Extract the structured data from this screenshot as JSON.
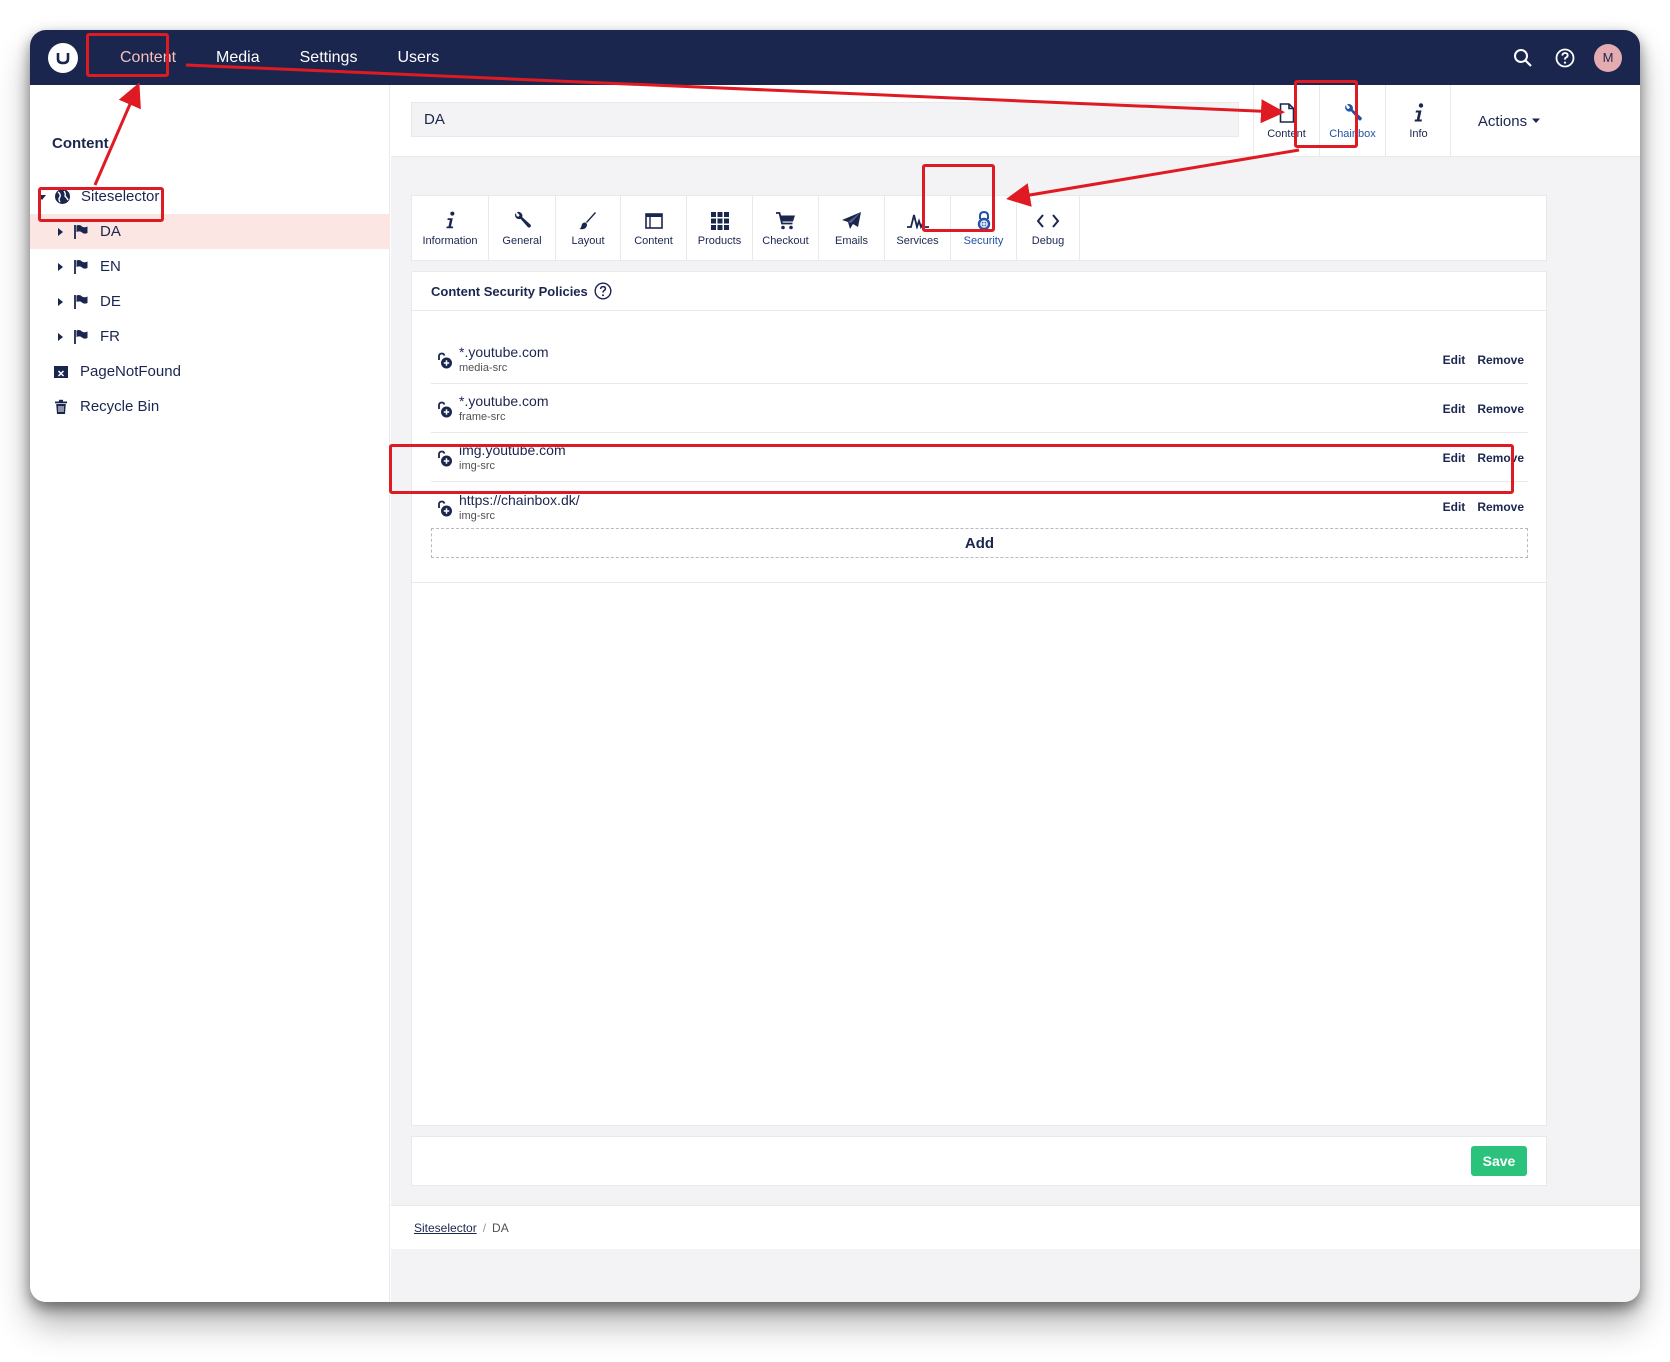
{
  "topnav": {
    "items": [
      {
        "label": "Content"
      },
      {
        "label": "Media"
      },
      {
        "label": "Settings"
      },
      {
        "label": "Users"
      }
    ],
    "avatar_initial": "M"
  },
  "sidebar": {
    "title": "Content",
    "root": {
      "label": "Siteselector"
    },
    "items": [
      {
        "label": "DA"
      },
      {
        "label": "EN"
      },
      {
        "label": "DE"
      },
      {
        "label": "FR"
      }
    ],
    "page_not_found": "PageNotFound",
    "recycle_bin": "Recycle Bin"
  },
  "editor": {
    "name": "DA",
    "apps": [
      {
        "label": "Content",
        "icon": "document-icon"
      },
      {
        "label": "Chainbox",
        "icon": "wrench-icon"
      },
      {
        "label": "Info",
        "icon": "info-icon"
      }
    ],
    "actions_label": "Actions"
  },
  "subtabs": [
    {
      "label": "Information",
      "icon": "info-icon"
    },
    {
      "label": "General",
      "icon": "wrench-icon"
    },
    {
      "label": "Layout",
      "icon": "brush-icon"
    },
    {
      "label": "Content",
      "icon": "layout-icon"
    },
    {
      "label": "Products",
      "icon": "grid-icon"
    },
    {
      "label": "Checkout",
      "icon": "cart-icon"
    },
    {
      "label": "Emails",
      "icon": "paper-plane-icon"
    },
    {
      "label": "Services",
      "icon": "pulse-icon"
    },
    {
      "label": "Security",
      "icon": "lock-icon"
    },
    {
      "label": "Debug",
      "icon": "code-icon"
    }
  ],
  "panel": {
    "title": "Content Security Policies",
    "policies": [
      {
        "value": "*.youtube.com",
        "directive": "media-src",
        "edit": "Edit",
        "remove": "Remove"
      },
      {
        "value": "*.youtube.com",
        "directive": "frame-src",
        "edit": "Edit",
        "remove": "Remove"
      },
      {
        "value": "img.youtube.com",
        "directive": "img-src",
        "edit": "Edit",
        "remove": "Remove"
      },
      {
        "value": "https://chainbox.dk/",
        "directive": "img-src",
        "edit": "Edit",
        "remove": "Remove"
      }
    ],
    "add_label": "Add"
  },
  "save_label": "Save",
  "breadcrumb": {
    "link": "Siteselector",
    "sep": "/",
    "current": "DA"
  },
  "colors": {
    "header": "#1b264f",
    "active_nav": "#f5c1bc",
    "save": "#2bc37c",
    "annotation": "#e01a22",
    "active_tab": "#2152a3"
  }
}
